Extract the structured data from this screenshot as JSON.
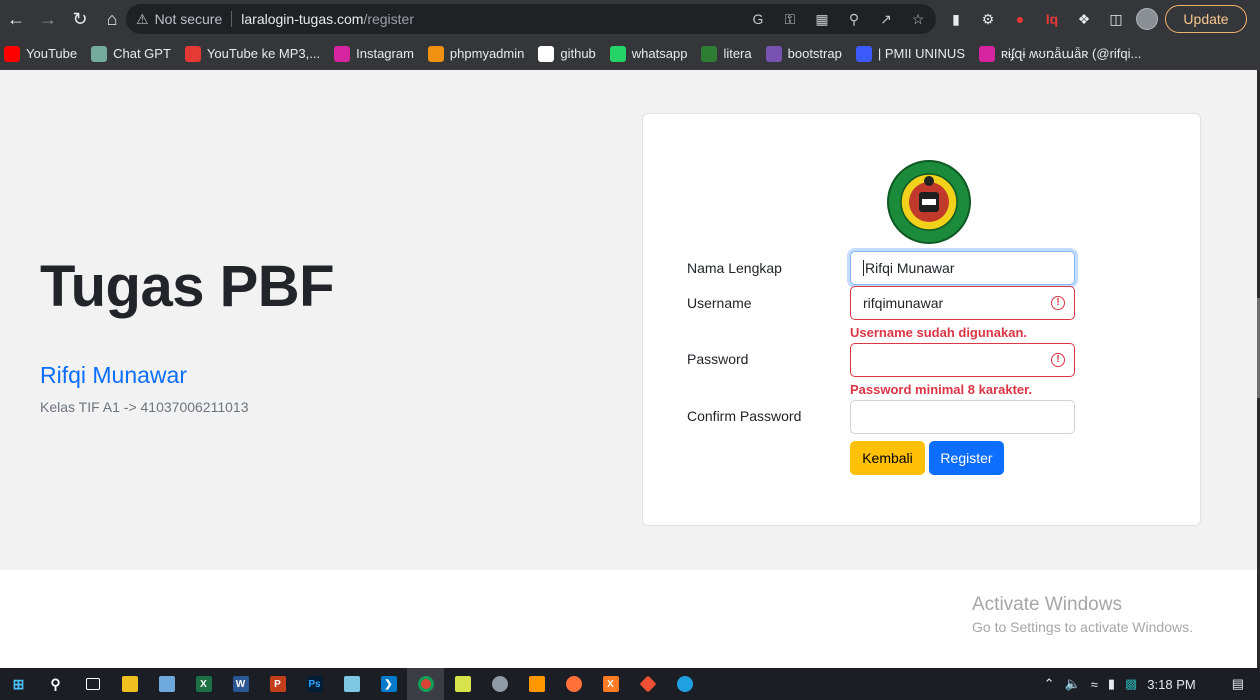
{
  "browser": {
    "address": {
      "security_label": "Not secure",
      "host": "laralogin-tugas.com",
      "path": "/register"
    },
    "update_label": "Update",
    "bookmarks": [
      {
        "label": "YouTube",
        "icon": "youtube-icon",
        "color": "#ff0000"
      },
      {
        "label": "Chat GPT",
        "icon": "chatgpt-icon",
        "color": "#74aa9c"
      },
      {
        "label": "YouTube ke MP3,...",
        "icon": "download-icon",
        "color": "#e53935"
      },
      {
        "label": "Instagram",
        "icon": "instagram-icon",
        "color": "#d6249f"
      },
      {
        "label": "phpmyadmin",
        "icon": "phpmyadmin-icon",
        "color": "#f29111"
      },
      {
        "label": "github",
        "icon": "github-icon",
        "color": "#ffffff"
      },
      {
        "label": "whatsapp",
        "icon": "whatsapp-icon",
        "color": "#25d366"
      },
      {
        "label": "litera",
        "icon": "litera-icon",
        "color": "#2e7d32"
      },
      {
        "label": "bootstrap",
        "icon": "bootstrap-icon",
        "color": "#7952b3"
      },
      {
        "label": "| PMII UNINUS",
        "icon": "pmii-icon",
        "color": "#3d5afe"
      },
      {
        "label": "ʀɨʄզɨ ʍʊռǟաǟʀ (@rifqi...",
        "icon": "instagram-icon",
        "color": "#d6249f"
      }
    ]
  },
  "hero": {
    "title": "Tugas PBF",
    "name": "Rifqi Munawar",
    "subtitle": "Kelas TIF A1 -> 41037006211013"
  },
  "form": {
    "logo_text": "UNIVERSITAS ISLAM NUSANTARA",
    "fields": {
      "nama": {
        "label": "Nama Lengkap",
        "value": "Rifqi Munawar"
      },
      "username": {
        "label": "Username",
        "value": "rifqimunawar",
        "error": "Username sudah digunakan."
      },
      "password": {
        "label": "Password",
        "value": "",
        "error": "Password minimal 8 karakter."
      },
      "confirm": {
        "label": "Confirm Password",
        "value": ""
      }
    },
    "buttons": {
      "back": "Kembali",
      "register": "Register"
    }
  },
  "windows_notice": {
    "title": "Activate Windows",
    "subtitle": "Go to Settings to activate Windows."
  },
  "taskbar": {
    "time": "3:18 PM"
  }
}
